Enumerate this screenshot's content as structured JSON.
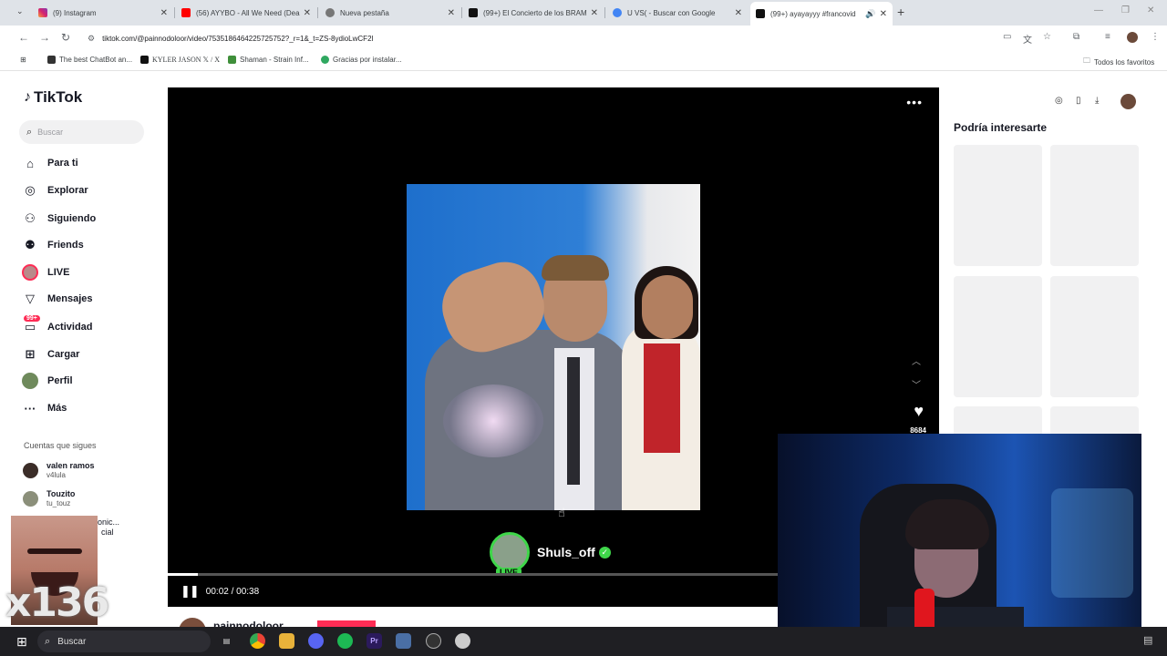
{
  "browser": {
    "tabs": [
      {
        "title": "(9) Instagram",
        "close": "✕"
      },
      {
        "title": "(56) AYYBO - All We Need (Dea",
        "close": "✕"
      },
      {
        "title": "Nueva pestaña",
        "close": "✕"
      },
      {
        "title": "(99+) El Concierto de los BRAM",
        "close": "✕"
      },
      {
        "title": "U VS( - Buscar con Google",
        "close": "✕"
      },
      {
        "title": "(99+) ayayayyy #francovid",
        "close": "✕"
      }
    ],
    "url": "tiktok.com/@painnodoloor/video/7535186464225725752?_r=1&_t=ZS-8ydioLwCF2l",
    "bookmarks": [
      "The best ChatBot an...",
      "KYLER JASON 𝕏 / X",
      "Shaman - Strain Inf...",
      "Gracias por instalar...",
      "Todos los favoritos"
    ]
  },
  "tiktok": {
    "logo": "TikTok",
    "search_placeholder": "Buscar",
    "nav": [
      {
        "label": "Para ti",
        "icon": "home-icon"
      },
      {
        "label": "Explorar",
        "icon": "compass-icon"
      },
      {
        "label": "Siguiendo",
        "icon": "following-icon"
      },
      {
        "label": "Friends",
        "icon": "friends-icon"
      },
      {
        "label": "LIVE",
        "icon": "live-icon"
      },
      {
        "label": "Mensajes",
        "icon": "messages-icon"
      },
      {
        "label": "Actividad",
        "icon": "activity-icon",
        "badge": "99+"
      },
      {
        "label": "Cargar",
        "icon": "upload-icon"
      },
      {
        "label": "Perfil",
        "icon": "profile-icon"
      },
      {
        "label": "Más",
        "icon": "more-icon"
      }
    ],
    "following_header": "Cuentas que sigues",
    "accounts": [
      {
        "name": "valen ramos",
        "handle": "v4lula"
      },
      {
        "name": "Touzito",
        "handle": "tu_touz"
      }
    ],
    "partial_account": {
      "line1": "onic...",
      "line2": "cial"
    },
    "video": {
      "live_user": "Shuls_off",
      "live_tag": "LIVE",
      "likes": "8684",
      "time": "00:02 / 00:38",
      "progress": 0.05,
      "author": "painnodoloor"
    },
    "recommend_title": "Podría interesarte"
  },
  "overlay": {
    "meme_count": "x136"
  },
  "taskbar": {
    "search": "Buscar",
    "apps": [
      "task-view",
      "chrome",
      "files",
      "discord",
      "spotify",
      "premiere",
      "calculator",
      "obs",
      "shield"
    ]
  },
  "colors": {
    "accent": "#fe2c55",
    "live_green": "#3fd64a",
    "video_bg": "#000000"
  }
}
